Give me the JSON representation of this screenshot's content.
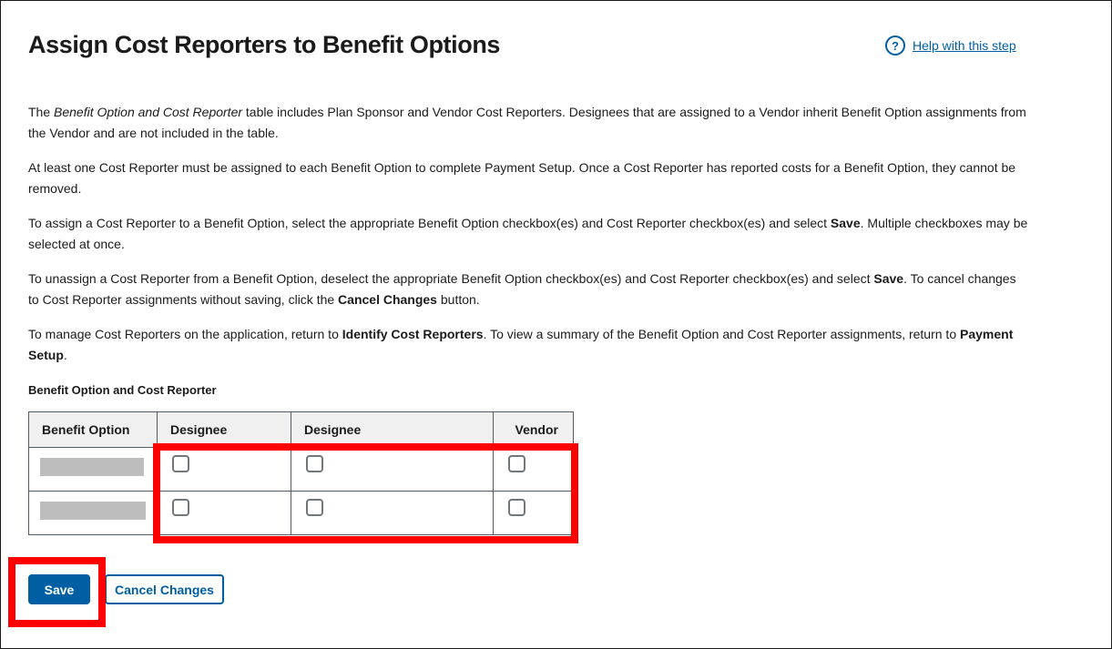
{
  "header": {
    "title": "Assign Cost Reporters to Benefit Options",
    "help_link": "Help with this step",
    "help_icon": "question-circle-icon"
  },
  "intro": {
    "p1": {
      "a": "The ",
      "italic": "Benefit Option and Cost Reporter",
      "b": " table includes Plan Sponsor and Vendor Cost Reporters. Designees that are assigned to a Vendor inherit Benefit Option assignments from the Vendor and are not included in the table."
    },
    "p2": "At least one Cost Reporter must be assigned to each Benefit Option to complete Payment Setup. Once a Cost Reporter has reported costs for a Benefit Option, they cannot be removed.",
    "p3": {
      "a": "To assign a Cost Reporter to a Benefit Option, select the appropriate Benefit Option checkbox(es) and Cost Reporter checkbox(es) and select ",
      "bold": "Save",
      "b": ". Multiple checkboxes may be selected at once."
    },
    "p4": {
      "a": "To unassign a Cost Reporter from a Benefit Option, deselect the appropriate Benefit Option checkbox(es) and Cost Reporter checkbox(es) and select ",
      "bold1": "Save",
      "b": ". To cancel changes to Cost Reporter assignments without saving, click the ",
      "bold2": "Cancel Changes",
      "c": " button."
    },
    "p5": {
      "a": "To manage Cost Reporters on the application, return to ",
      "bold1": "Identify Cost Reporters",
      "b": ". To view a summary of the Benefit Option and Cost Reporter assignments, return to ",
      "bold2": "Payment Setup",
      "c": "."
    }
  },
  "table": {
    "caption": "Benefit Option and Cost Reporter",
    "columns": [
      "Benefit Option",
      "Designee",
      "Designee",
      "Vendor"
    ],
    "rows": [
      {
        "benefit_option": "[redacted]",
        "checked": [
          false,
          false,
          false
        ]
      },
      {
        "benefit_option": "[redacted]",
        "checked": [
          false,
          false,
          false
        ]
      }
    ]
  },
  "buttons": {
    "save": "Save",
    "cancel": "Cancel Changes"
  },
  "annotations": {
    "highlight_color": "#ff0000"
  }
}
